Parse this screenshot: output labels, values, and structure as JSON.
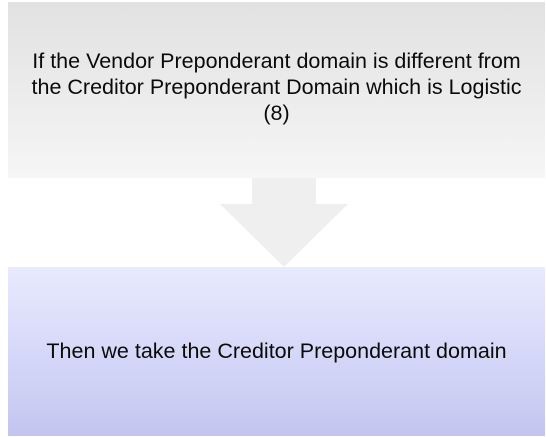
{
  "diagram": {
    "condition_text": "If the Vendor Preponderant domain is different from the Creditor Preponderant Domain which is Logistic (8)",
    "result_text": "Then we take the Creditor Preponderant domain"
  },
  "colors": {
    "condition_box": "#ececec",
    "arrow": "#efefef",
    "result_box": "#d3d5f7"
  }
}
